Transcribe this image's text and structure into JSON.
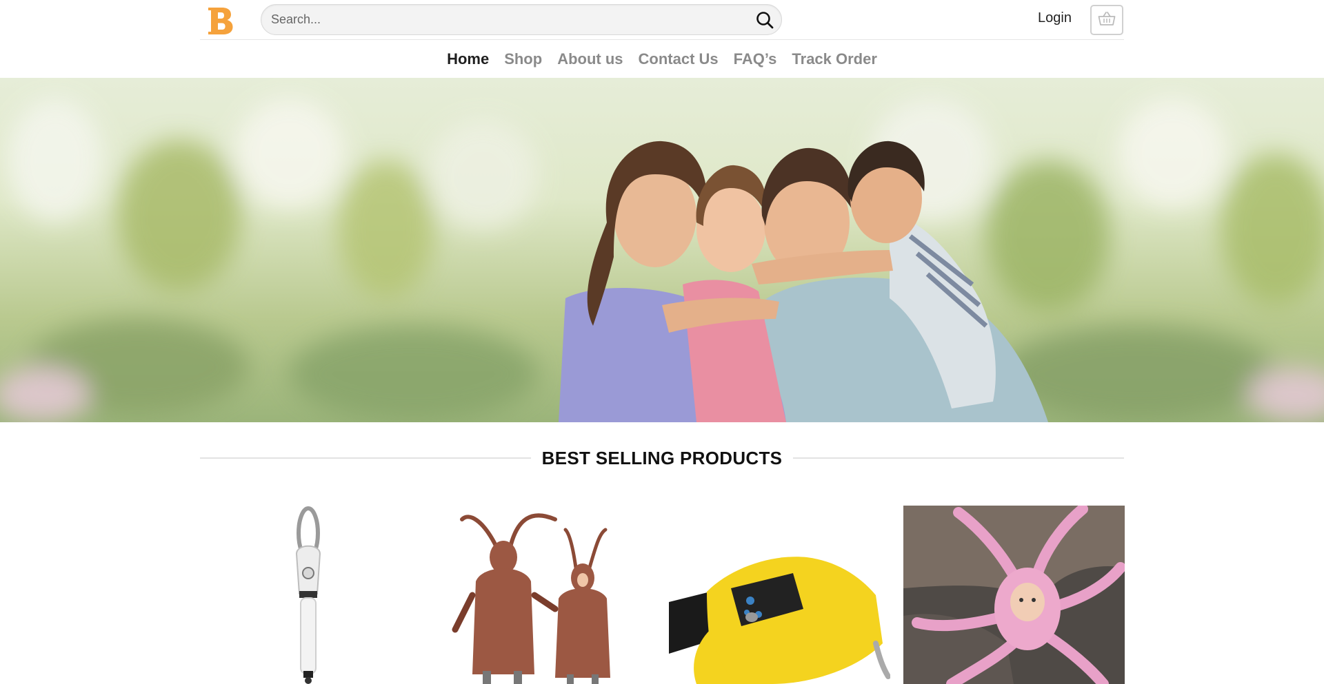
{
  "header": {
    "logo_letter": "B",
    "search_placeholder": "Search...",
    "login_label": "Login",
    "cart_icon": "basket-icon",
    "search_icon": "search-icon"
  },
  "nav": {
    "items": [
      {
        "label": "Home",
        "active": true
      },
      {
        "label": "Shop",
        "active": false
      },
      {
        "label": "About us",
        "active": false
      },
      {
        "label": "Contact Us",
        "active": false
      },
      {
        "label": "FAQ’s",
        "active": false
      },
      {
        "label": "Track Order",
        "active": false
      }
    ]
  },
  "section": {
    "title": "BEST SELLING PRODUCTS"
  },
  "products": [
    {
      "image": "drain-plunger-tool"
    },
    {
      "image": "cockroach-costumes"
    },
    {
      "image": "yellow-bluetooth-gloves"
    },
    {
      "image": "pink-octopus-costume"
    }
  ],
  "colors": {
    "logo": "#F5A23C",
    "nav_active": "#1f1f1f",
    "nav_inactive": "#8a8a8a"
  }
}
